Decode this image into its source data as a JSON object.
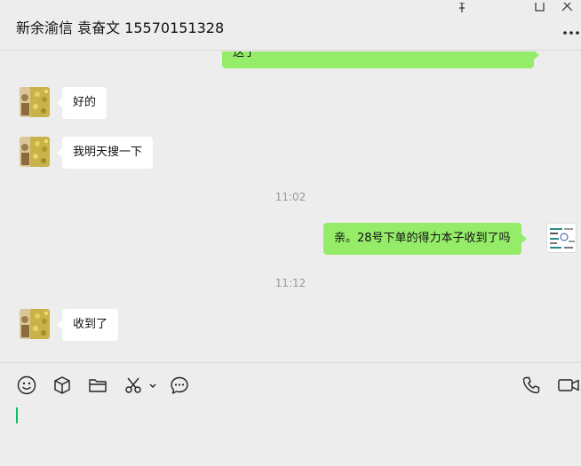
{
  "chat": {
    "title": "新余渝信 袁奋文 15570151328"
  },
  "messages": [
    {
      "direction": "out",
      "text": "送了"
    },
    {
      "direction": "in",
      "text": "好的"
    },
    {
      "direction": "in",
      "text": "我明天搜一下"
    },
    {
      "direction": "time",
      "text": "11:02"
    },
    {
      "direction": "out",
      "text": "亲。28号下单的得力本子收到了吗"
    },
    {
      "direction": "time",
      "text": "11:12"
    },
    {
      "direction": "in",
      "text": "收到了"
    }
  ],
  "toolbar": {
    "left_icons": [
      "emoji-icon",
      "package-icon",
      "folder-icon",
      "scissors-icon",
      "chevron-down-icon",
      "chat-history-icon"
    ],
    "right_icons": [
      "phone-icon",
      "video-call-icon"
    ]
  },
  "colors": {
    "outgoing_bubble": "#95ec69",
    "incoming_bubble": "#ffffff",
    "background": "#ededed",
    "caret": "#07c160"
  }
}
